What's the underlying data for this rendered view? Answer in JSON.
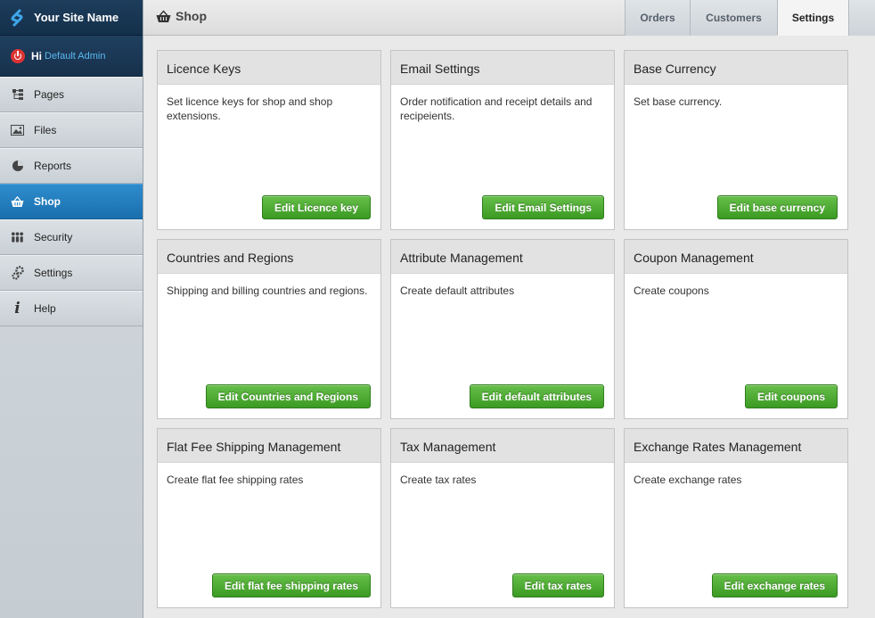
{
  "brand": {
    "name": "Your Site Name"
  },
  "user": {
    "greeting": "Hi",
    "name": "Default Admin"
  },
  "sidebar": {
    "items": [
      {
        "label": "Pages",
        "icon": "sitemap-icon",
        "active": false
      },
      {
        "label": "Files",
        "icon": "image-icon",
        "active": false
      },
      {
        "label": "Reports",
        "icon": "pie-chart-icon",
        "active": false
      },
      {
        "label": "Shop",
        "icon": "basket-icon",
        "active": true
      },
      {
        "label": "Security",
        "icon": "users-icon",
        "active": false
      },
      {
        "label": "Settings",
        "icon": "gears-icon",
        "active": false
      },
      {
        "label": "Help",
        "icon": "info-icon",
        "active": false
      }
    ]
  },
  "header": {
    "title": "Shop",
    "tabs": [
      {
        "label": "Orders",
        "active": false
      },
      {
        "label": "Customers",
        "active": false
      },
      {
        "label": "Settings",
        "active": true
      }
    ]
  },
  "cards": [
    {
      "title": "Licence Keys",
      "desc": "Set licence keys for shop and shop extensions.",
      "button": "Edit Licence key"
    },
    {
      "title": "Email Settings",
      "desc": "Order notification and receipt details and recipeients.",
      "button": "Edit Email Settings"
    },
    {
      "title": "Base Currency",
      "desc": "Set base currency.",
      "button": "Edit base currency"
    },
    {
      "title": "Countries and Regions",
      "desc": "Shipping and billing countries and regions.",
      "button": "Edit Countries and Regions"
    },
    {
      "title": "Attribute Management",
      "desc": "Create default attributes",
      "button": "Edit default attributes"
    },
    {
      "title": "Coupon Management",
      "desc": "Create coupons",
      "button": "Edit coupons"
    },
    {
      "title": "Flat Fee Shipping Management",
      "desc": "Create flat fee shipping rates",
      "button": "Edit flat fee shipping rates"
    },
    {
      "title": "Tax Management",
      "desc": "Create tax rates",
      "button": "Edit tax rates"
    },
    {
      "title": "Exchange Rates Management",
      "desc": "Create exchange rates",
      "button": "Edit exchange rates"
    }
  ],
  "colors": {
    "accent": "#1f7cc0",
    "button_green": "#4aa92f",
    "sidebar_dark": "#17314c"
  }
}
